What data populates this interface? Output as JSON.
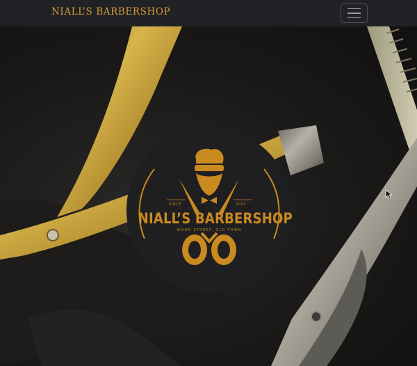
{
  "navbar": {
    "brand": "NIALL’S BARBERSHOP",
    "menu_toggle_icon": "hamburger-icon"
  },
  "hero": {
    "background_image": "barber-tools-photo",
    "logo": {
      "title": "NIALL’S BARBERSHOP",
      "subtitle": "WOOD STREET, OLD TOWN",
      "since_label": "SINCE",
      "year": "2023"
    }
  },
  "colors": {
    "navbar_bg": "#212225",
    "brand_gold": "#d79c38",
    "logo_bg": "#1f1f21",
    "logo_gold": "#c98a1f"
  }
}
